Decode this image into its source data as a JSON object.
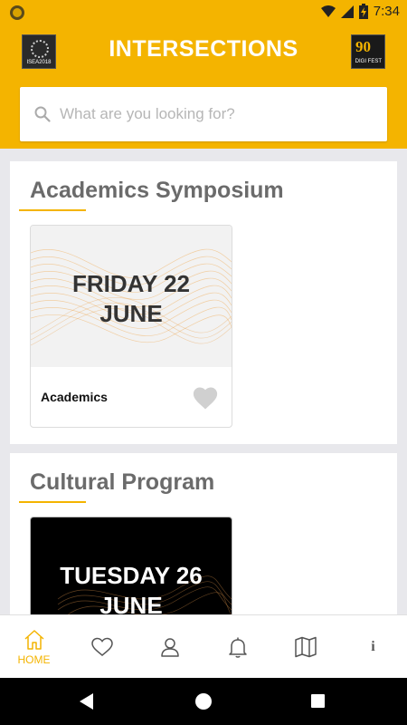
{
  "status_bar": {
    "time": "7:34",
    "icons": [
      "app-notification-icon",
      "wifi-icon",
      "signal-icon",
      "battery-charging-icon"
    ]
  },
  "header": {
    "title": "INTERSECTIONS",
    "logo_left": "ISEA2018",
    "logo_right": "DIGI FEST",
    "background_color": "#f4b400"
  },
  "search": {
    "placeholder": "What are you looking for?",
    "value": ""
  },
  "sections": [
    {
      "title": "Academics Symposium",
      "cards": [
        {
          "date_line1": "FRIDAY 22",
          "date_line2": "JUNE",
          "label": "Academics",
          "image_theme": "light"
        }
      ]
    },
    {
      "title": "Cultural Program",
      "cards": [
        {
          "date_line1": "TUESDAY 26",
          "date_line2": "JUNE",
          "label": "",
          "image_theme": "dark"
        }
      ]
    }
  ],
  "bottom_nav": {
    "items": [
      {
        "label": "HOME",
        "icon": "home-icon",
        "active": true
      },
      {
        "label": "",
        "icon": "heart-icon",
        "active": false
      },
      {
        "label": "",
        "icon": "person-icon",
        "active": false
      },
      {
        "label": "",
        "icon": "bell-icon",
        "active": false
      },
      {
        "label": "",
        "icon": "map-icon",
        "active": false
      },
      {
        "label": "",
        "icon": "info-icon",
        "active": false
      }
    ],
    "active_color": "#f4b400",
    "inactive_color": "#555555"
  },
  "android_nav": {
    "icons": [
      "back-icon",
      "home-circle-icon",
      "recents-icon"
    ]
  },
  "colors": {
    "accent": "#f4b400",
    "section_title": "#6b6b6b",
    "page_background": "#e8e8ec"
  }
}
